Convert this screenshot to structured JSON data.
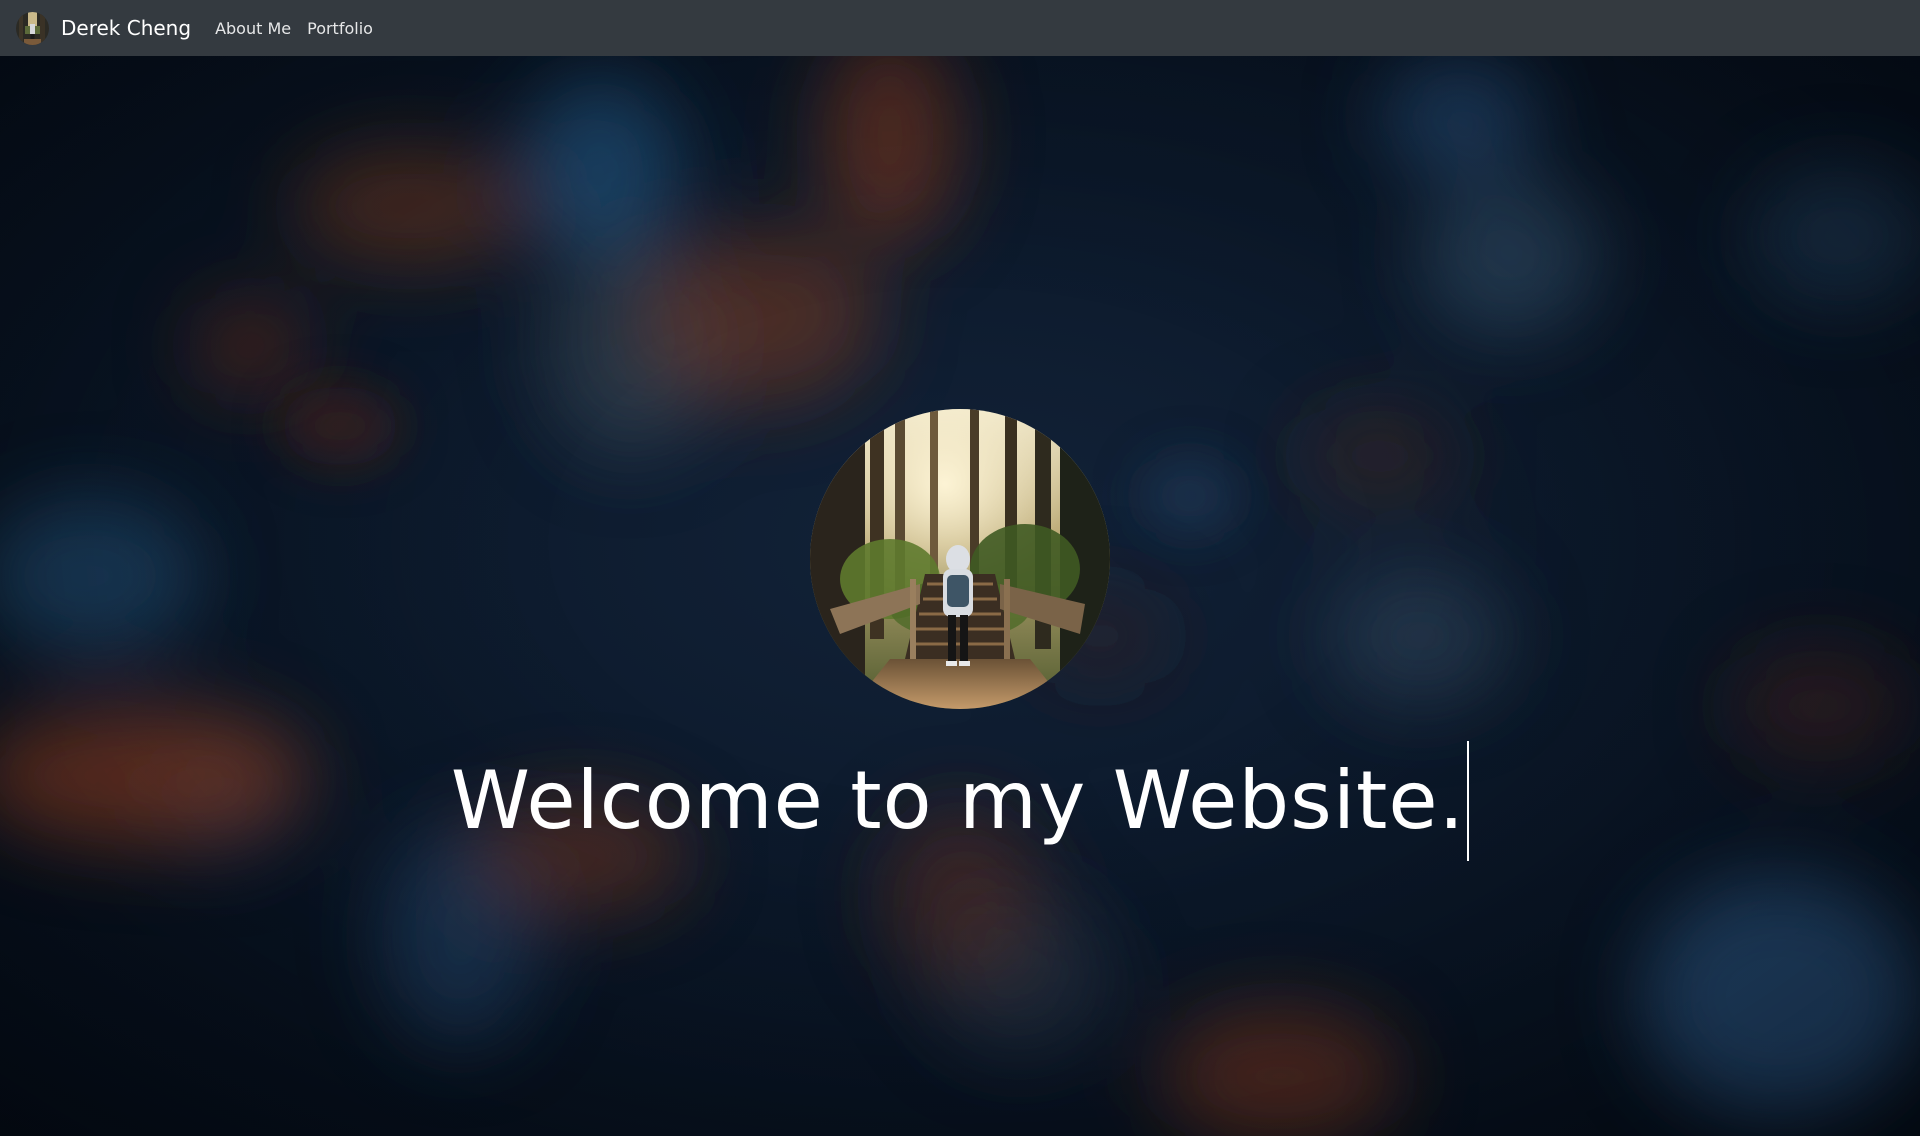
{
  "navbar": {
    "brand_name": "Derek Cheng",
    "avatar_icon": "profile-photo-forest-path",
    "links": [
      {
        "label": "About Me"
      },
      {
        "label": "Portfolio"
      }
    ],
    "background": "#343a40"
  },
  "hero": {
    "headline": "Welcome to my Website.",
    "profile_image": "hiker-on-forest-stairs-photo",
    "background_style": "blurred-bokeh-dark-blue-orange",
    "colors": {
      "base": "#08121e",
      "blue_bokeh": "#2a5a85",
      "orange_bokeh": "#8a3e1e",
      "text": "#ffffff"
    }
  }
}
